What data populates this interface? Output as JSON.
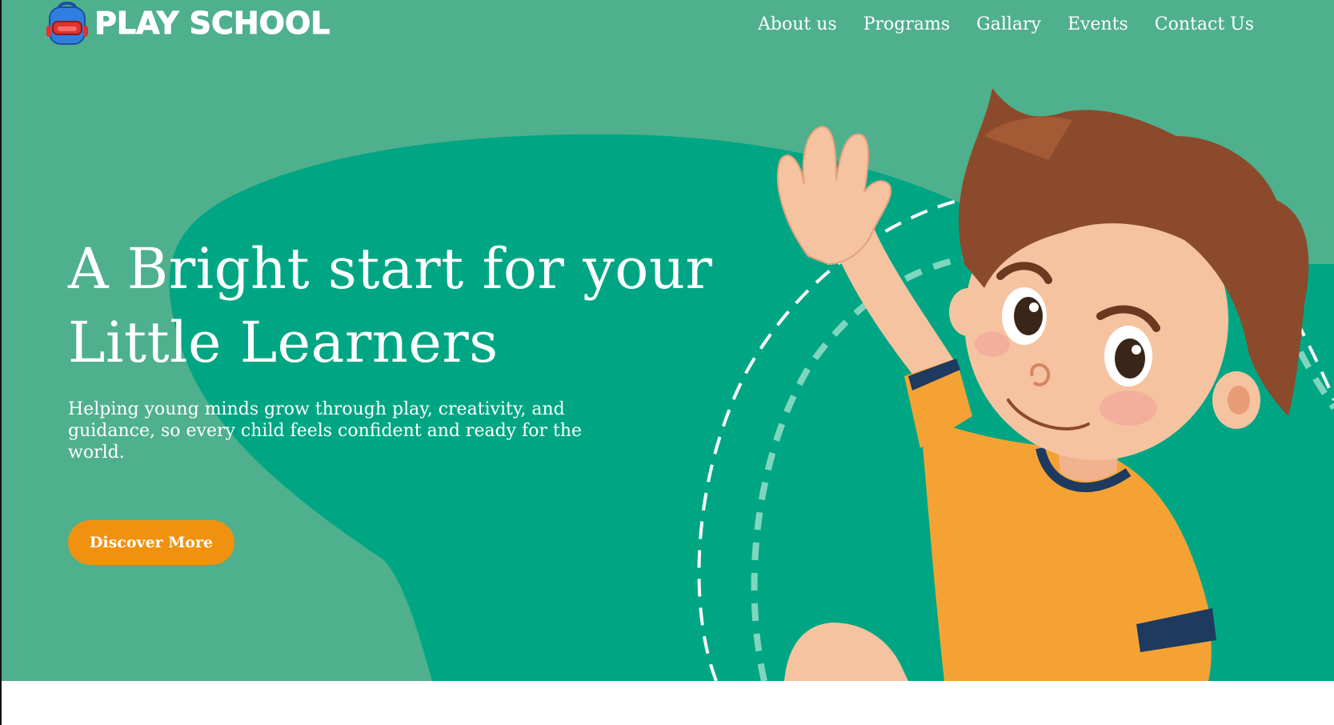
{
  "brand": {
    "name": "PLAY SCHOOL",
    "logo_icon": "backpack-icon"
  },
  "nav": {
    "items": [
      {
        "label": "About us"
      },
      {
        "label": "Programs"
      },
      {
        "label": "Gallary"
      },
      {
        "label": "Events"
      },
      {
        "label": "Contact Us"
      }
    ]
  },
  "hero": {
    "headline_line1": "A Bright start for your",
    "headline_line2": "Little Learners",
    "subtext": "Helping young minds grow through play, creativity, and guidance, so every child feels confident and ready for the world.",
    "cta_label": "Discover More",
    "illustration": "waving-boy-illustration"
  },
  "colors": {
    "hero_background": "#4fb08d",
    "hero_blob": "#00a683",
    "cta": "#f0920f",
    "text": "#ffffff",
    "page_background": "#ffffff"
  }
}
